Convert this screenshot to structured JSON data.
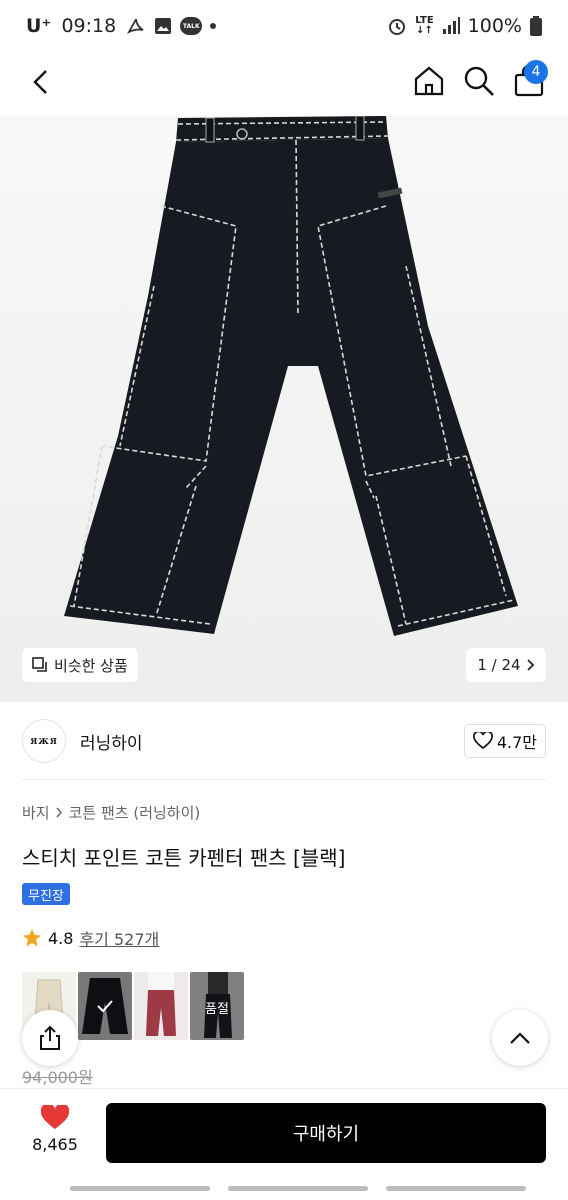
{
  "status_bar": {
    "carrier": "U⁺",
    "time": "09:18",
    "talk": "TALK",
    "lte": "LTE",
    "battery": "100%"
  },
  "header": {
    "cart_count": "4"
  },
  "hero": {
    "similar_label": "비슷한 상품",
    "page_indicator": "1 / 24"
  },
  "brand": {
    "logo_text": "ЯЖЯ",
    "name": "러닝하이",
    "likes": "4.7만"
  },
  "product": {
    "breadcrumb": [
      "바지",
      "코튼 팬츠 (러닝하이)"
    ],
    "title": "스티치 포인트 코튼 카펜터 팬츠 [블랙]",
    "tag": "무진장",
    "rating": "4.8",
    "reviews": "후기 527개",
    "soldout_label": "품절",
    "old_price": "94,000원"
  },
  "bottom": {
    "wish_count": "8,465",
    "buy_label": "구매하기"
  },
  "colors": {
    "accent": "#1a73e8",
    "badge": "#2f6fe4",
    "heart": "#e53935",
    "star": "#f5a623"
  }
}
